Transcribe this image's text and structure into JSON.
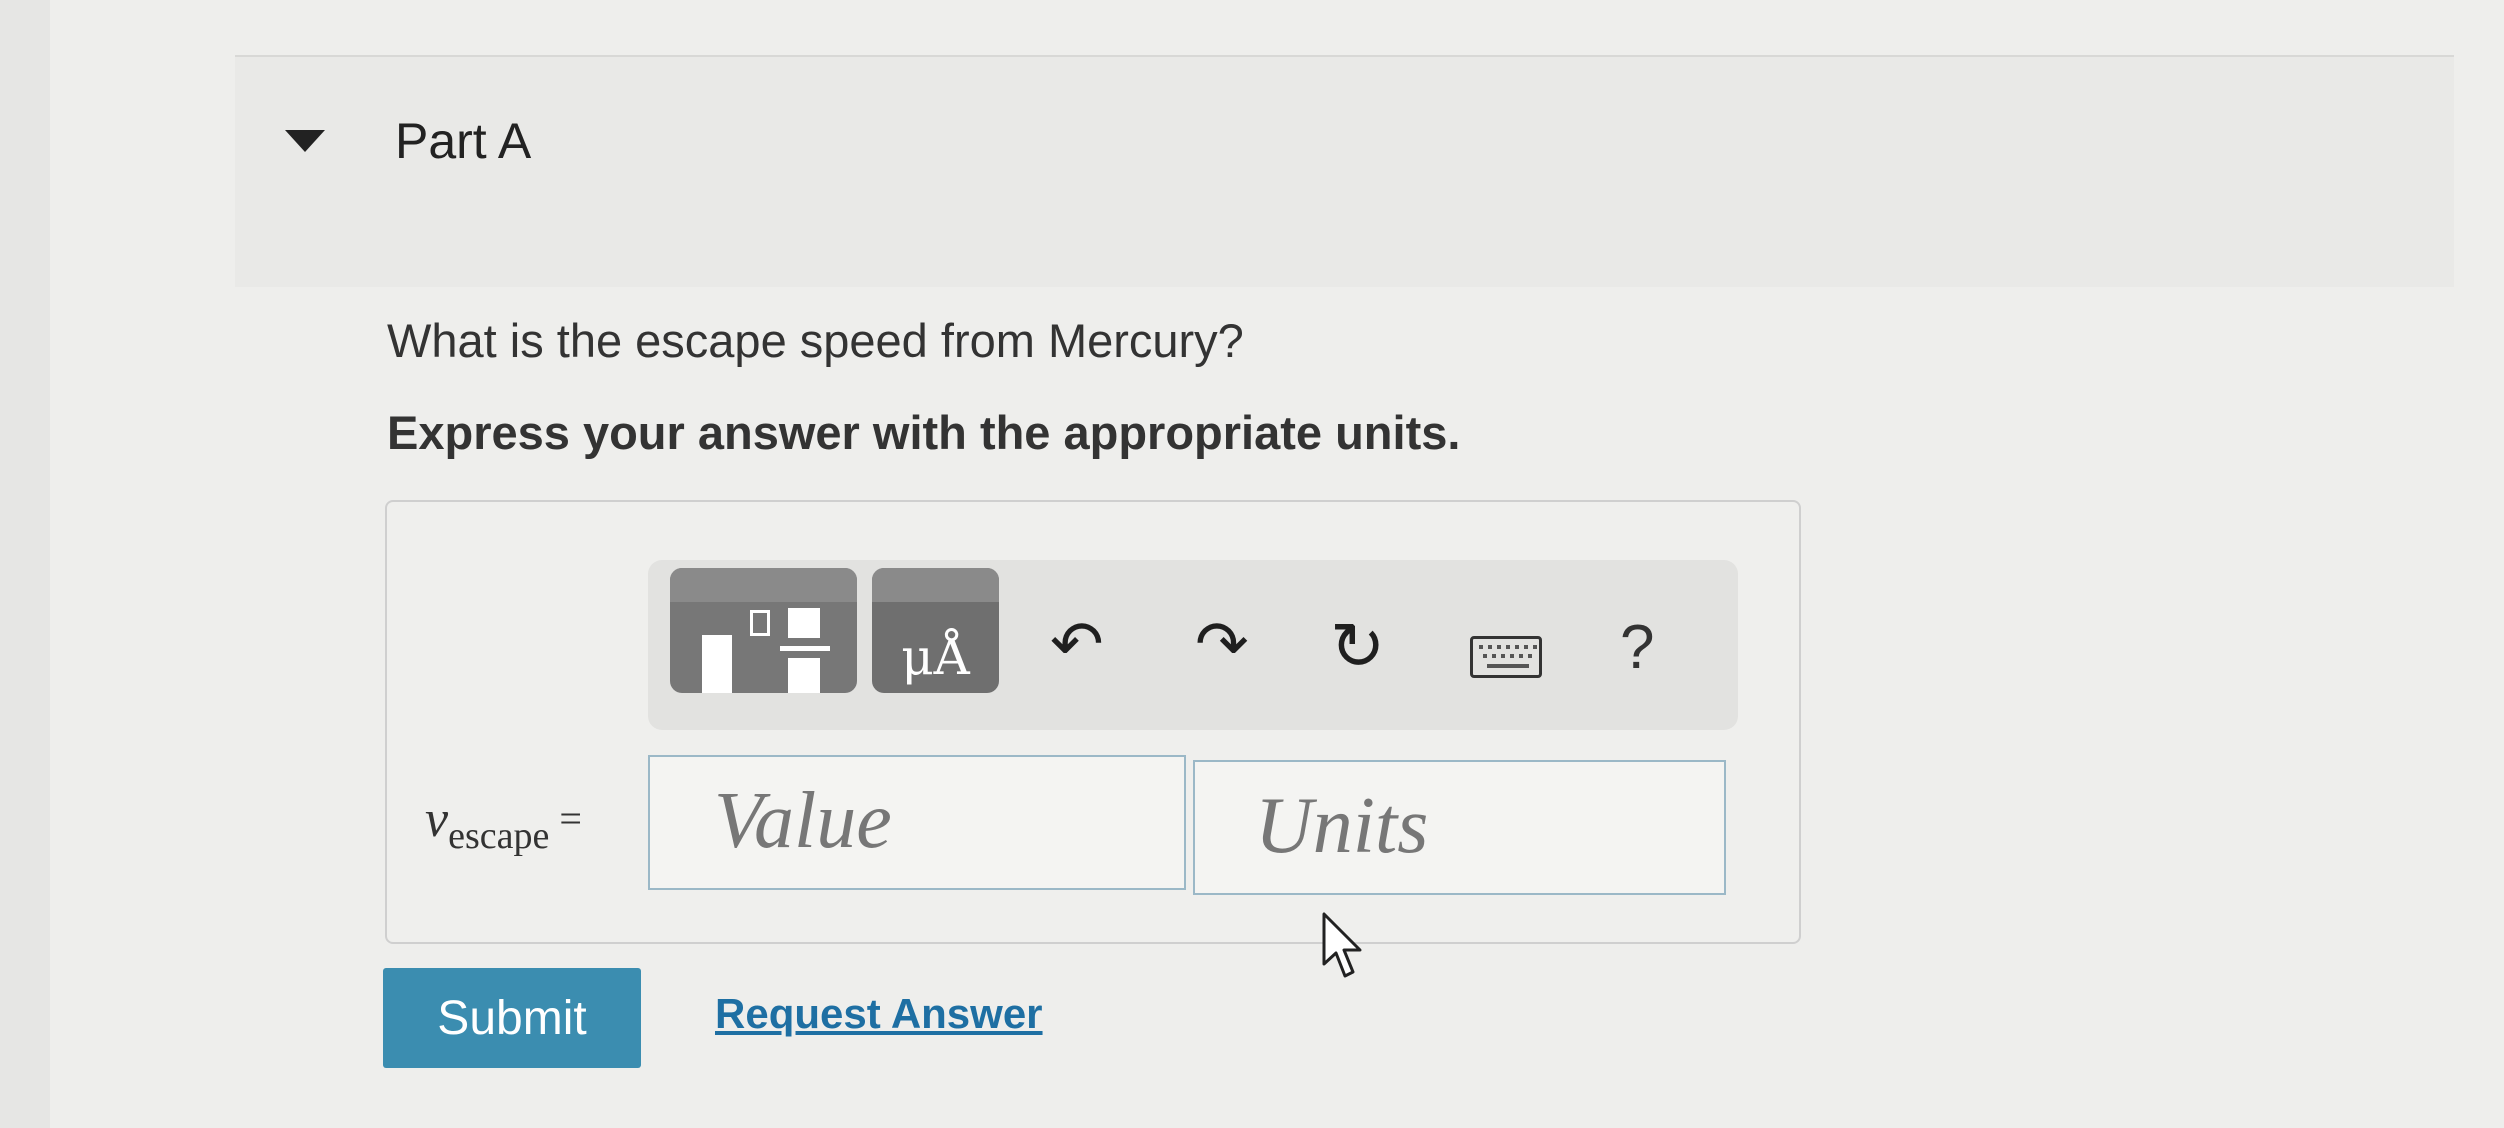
{
  "part": {
    "title": "Part A"
  },
  "question": {
    "text": "What is the escape speed from Mercury?",
    "instruction": "Express your answer with the appropriate units."
  },
  "toolbar": {
    "templates_icon": "templates-icon",
    "units_label": "μÅ",
    "undo_glyph": "↶",
    "redo_glyph": "↷",
    "reset_glyph": "↻",
    "help_label": "?"
  },
  "answer": {
    "variable": "v",
    "subscript": "escape",
    "equals": "=",
    "value_placeholder": "Value",
    "units_placeholder": "Units"
  },
  "actions": {
    "submit_label": "Submit",
    "request_answer_label": "Request Answer"
  },
  "colors": {
    "submit_bg": "#3b8db0",
    "link": "#1e6fa3"
  }
}
